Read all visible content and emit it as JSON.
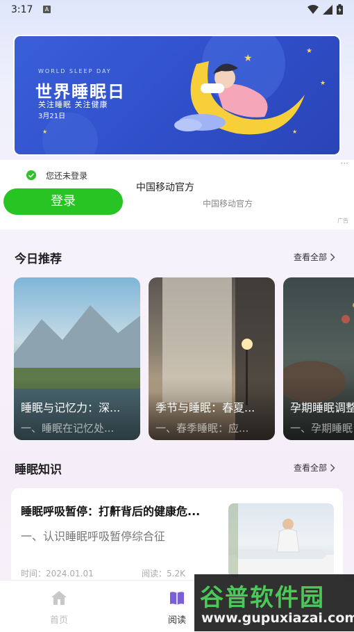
{
  "status_bar": {
    "time": "3:17",
    "notification_letter": "A"
  },
  "banner": {
    "subtitle": "WORLD SLEEP DAY",
    "title": "世界睡眠日",
    "tagline": "关注睡眠  关注健康",
    "date": "3月21日"
  },
  "ad": {
    "login_status": "您还未登录",
    "login_button": "登录",
    "title": "中国移动官方",
    "subtitle": "中国移动官方",
    "ad_label": "广告"
  },
  "recommend": {
    "title": "今日推荐",
    "view_all": "查看全部",
    "cards": [
      {
        "title": "睡眠与记忆力：深...",
        "desc": "一、睡眠在记忆处..."
      },
      {
        "title": "季节与睡眠：春夏...",
        "desc": "一、春季睡眠：应..."
      },
      {
        "title": "孕期睡眠调整",
        "desc": "一、孕期睡眠"
      }
    ]
  },
  "knowledge": {
    "title": "睡眠知识",
    "view_all": "查看全部",
    "article": {
      "title": "睡眠呼吸暂停：打鼾背后的健康危...",
      "desc": "一、认识睡眠呼吸暂停综合征",
      "time": "时间：2024.01.01",
      "reads": "阅读：5.2K"
    }
  },
  "tabs": [
    {
      "label": "首页",
      "icon": "home-icon",
      "active": false
    },
    {
      "label": "阅读",
      "icon": "book-icon",
      "active": true
    }
  ],
  "watermark": {
    "name": "谷普软件园",
    "url": "www.gupuxiazai.com"
  },
  "colors": {
    "accent_green": "#27c424",
    "tab_active": "#7b5fd6",
    "tab_inactive": "#bdbdbd"
  }
}
